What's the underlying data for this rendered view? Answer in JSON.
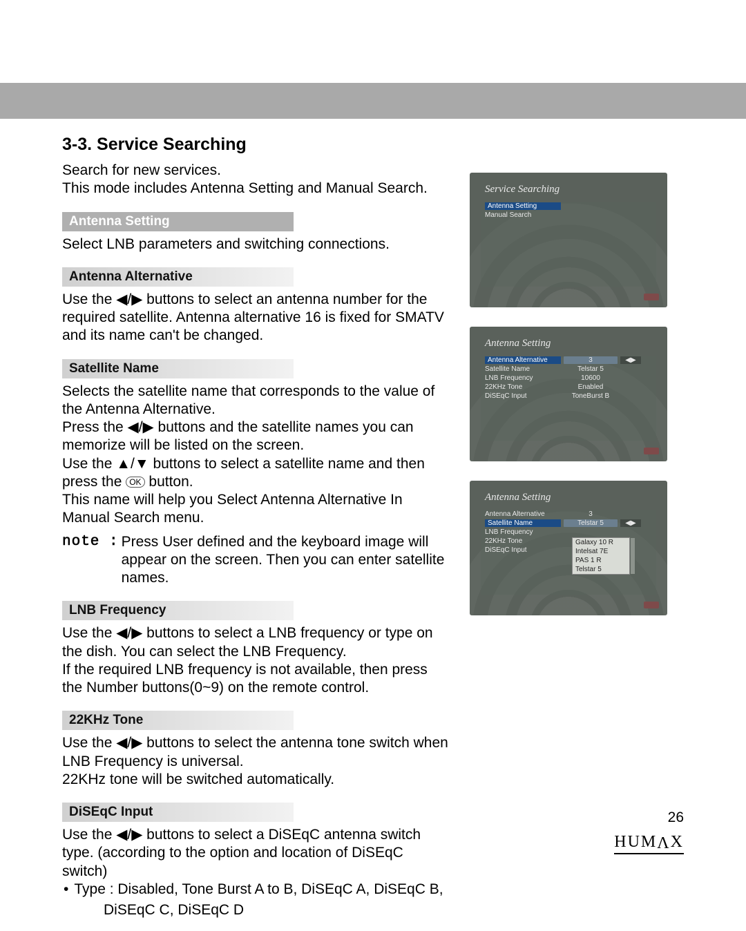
{
  "heading": "3-3. Service Searching",
  "intro1": "Search for new services.",
  "intro2": "This mode includes Antenna Setting and Manual Search.",
  "sec_antenna_setting": "Antenna Setting",
  "antenna_setting_body": "Select LNB parameters and switching connections.",
  "sec_antenna_alt": "Antenna Alternative",
  "antenna_alt_body": "Use the ◀/▶ buttons to select an antenna number for the required satellite. Antenna alternative 16 is fixed for SMATV and its name can't be changed.",
  "sec_sat_name": "Satellite Name",
  "sat_name_p1": "Selects the satellite name that corresponds to the value of the Antenna Alternative.",
  "sat_name_p2": "Press the ◀/▶ buttons and the satellite names you can memorize will be listed on the screen.",
  "sat_name_p3a": "Use the ▲/▼ buttons to select a satellite name and then press the ",
  "sat_name_ok": "OK",
  "sat_name_p3b": " button.",
  "sat_name_p4": "This name will help you Select Antenna Alternative In Manual Search menu.",
  "note_label": "note :",
  "note_body": "Press User defined and the keyboard image will appear on the screen. Then you can enter satellite names.",
  "sec_lnb": "LNB Frequency",
  "lnb_p1": "Use the ◀/▶ buttons to select a LNB frequency or type on the dish. You can select the LNB Frequency.",
  "lnb_p2": "If the required LNB frequency is not available, then press the Number buttons(0~9) on the remote control.",
  "sec_22k": "22KHz Tone",
  "k22_p1": "Use the ◀/▶ buttons to select the antenna tone switch when LNB Frequency is universal.",
  "k22_p2": "22KHz tone will be switched automatically.",
  "sec_diseqc": "DiSEqC Input",
  "diseqc_p1": "Use the ◀/▶ buttons to select a DiSEqC antenna switch type. (according to the option and location of DiSEqC switch)",
  "diseqc_bullet": "• ",
  "diseqc_type_l1": "Type : Disabled, Tone Burst A to B, DiSEqC A, DiSEqC B,",
  "diseqc_type_l2": "DiSEqC C, DiSEqC D",
  "page_number": "26",
  "brand_text": "HUMAX",
  "tv1": {
    "title": "Service Searching",
    "items": [
      "Antenna Setting",
      "Manual Search"
    ]
  },
  "tv2": {
    "title": "Antenna Setting",
    "rows": {
      "alt": {
        "k": "Antenna Alternative",
        "v": "3"
      },
      "sat": {
        "k": "Satellite Name",
        "v": "Telstar 5"
      },
      "lnb": {
        "k": "LNB Frequency",
        "v": "10600"
      },
      "tone": {
        "k": "22KHz Tone",
        "v": "Enabled"
      },
      "dis": {
        "k": "DiSEqC Input",
        "v": "ToneBurst B"
      }
    },
    "arrows": "◀▶"
  },
  "tv3": {
    "title": "Antenna Setting",
    "rows": {
      "alt": {
        "k": "Antenna Alternative",
        "v": "3"
      },
      "sat": {
        "k": "Satellite Name",
        "v": "Telstar 5"
      },
      "lnb": {
        "k": "LNB Frequency",
        "v": ""
      },
      "tone": {
        "k": "22KHz Tone",
        "v": ""
      },
      "dis": {
        "k": "DiSEqC Input",
        "v": ""
      }
    },
    "arrows": "◀▶",
    "dropdown": [
      "Galaxy 10 R",
      "Intelsat 7E",
      "PAS 1 R",
      "Telstar 5"
    ]
  }
}
